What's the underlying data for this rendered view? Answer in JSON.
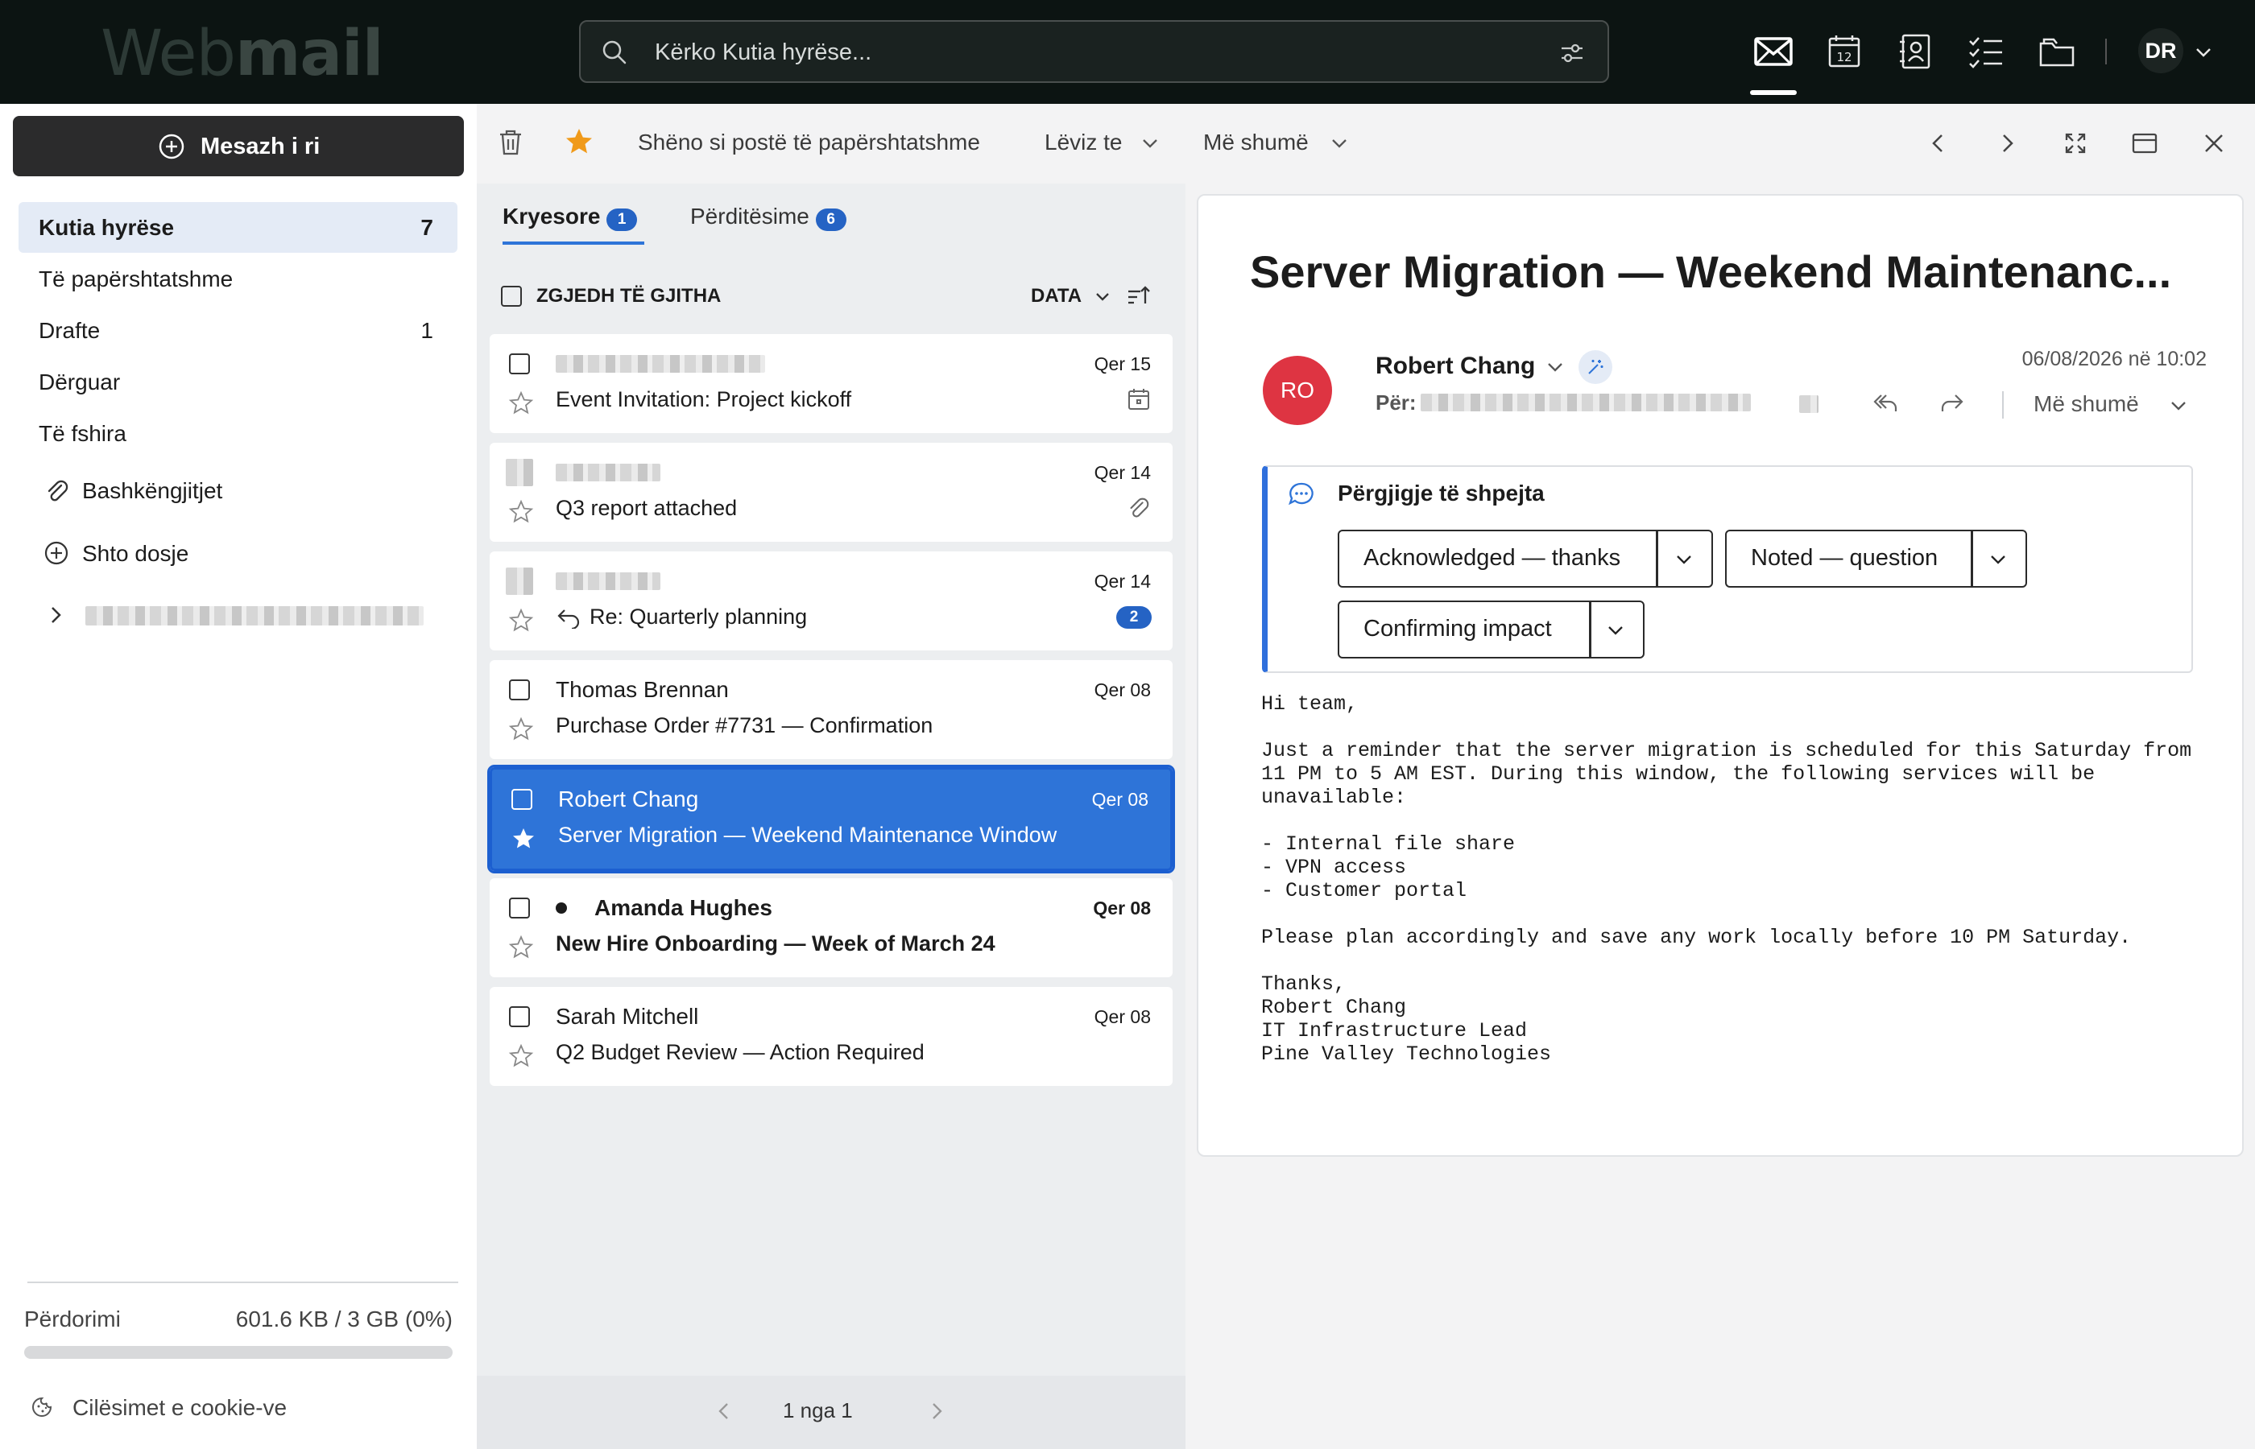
{
  "app": {
    "logo_light": "Web",
    "logo_bold": "mail"
  },
  "search": {
    "placeholder": "Kërko Kutia hyrëse..."
  },
  "topnav": {
    "avatar_initials": "DR",
    "active": "mail"
  },
  "sidebar": {
    "new_message": "Mesazh i ri",
    "folders": [
      {
        "name": "Kutia hyrëse",
        "count": "7",
        "selected": true
      },
      {
        "name": "Të papërshtatshme",
        "count": ""
      },
      {
        "name": "Drafte",
        "count": "1"
      },
      {
        "name": "Dërguar",
        "count": ""
      },
      {
        "name": "Të fshira",
        "count": ""
      }
    ],
    "attachments": "Bashkëngjitjet",
    "add_folder": "Shto dosje",
    "storage_label": "Përdorimi",
    "storage_value": "601.6 KB / 3 GB (0%)",
    "storage_fraction": 0.0,
    "cookie_settings": "Cilësimet e cookie-ve"
  },
  "toolbar": {
    "mark_spam": "Shëno si postë të papërshtatshme",
    "move_to": "Lëviz te",
    "more": "Më shumë"
  },
  "list": {
    "tabs": [
      {
        "label": "Kryesore",
        "badge": "1",
        "active": true
      },
      {
        "label": "Përditësime",
        "badge": "6",
        "active": false
      }
    ],
    "select_all": "ZGJEDH TË GJITHA",
    "sort_label": "DATA",
    "messages": [
      {
        "sender": "",
        "subject": "Event Invitation: Project kickoff",
        "date": "Qer 15",
        "indicator": "calendar-icon"
      },
      {
        "sender": "",
        "subject": "Q3 report attached",
        "date": "Qer 14",
        "indicator": "paperclip-icon"
      },
      {
        "sender": "",
        "subject": "Re: Quarterly planning",
        "date": "Qer 14",
        "thread_count": "2"
      },
      {
        "sender": "Thomas Brennan",
        "subject": "Purchase Order #7731 — Confirmation",
        "date": "Qer 08"
      },
      {
        "sender": "Robert Chang",
        "subject": "Server Migration — Weekend Maintenance Window",
        "date": "Qer 08",
        "selected": true,
        "starred": true
      },
      {
        "sender": "Amanda Hughes",
        "subject": "New Hire Onboarding — Week of March 24",
        "date": "Qer 08",
        "unread": true
      },
      {
        "sender": "Sarah Mitchell",
        "subject": "Q2 Budget Review — Action Required",
        "date": "Qer 08"
      }
    ],
    "pager": "1 nga 1"
  },
  "reading": {
    "title": "Server Migration — Weekend Maintenanc...",
    "avatar_initials": "RO",
    "sender": "Robert Chang",
    "to_label": "Për:",
    "datetime": "06/08/2026 në 10:02",
    "more": "Më shumë",
    "quick_replies_title": "Përgjigje të shpejta",
    "quick_replies": [
      "Acknowledged — thanks",
      "Noted — question",
      "Confirming impact"
    ],
    "body": "Hi team,\n\nJust a reminder that the server migration is scheduled for this Saturday from\n11 PM to 5 AM EST. During this window, the following services will be\nunavailable:\n\n- Internal file share\n- VPN access\n- Customer portal\n\nPlease plan accordingly and save any work locally before 10 PM Saturday.\n\nThanks,\nRobert Chang\nIT Infrastructure Lead\nPine Valley Technologies"
  },
  "colors": {
    "accent": "#2e74d8",
    "avatar_red": "#de3442",
    "topbar": "#0c1412",
    "star": "#f09a1a"
  }
}
